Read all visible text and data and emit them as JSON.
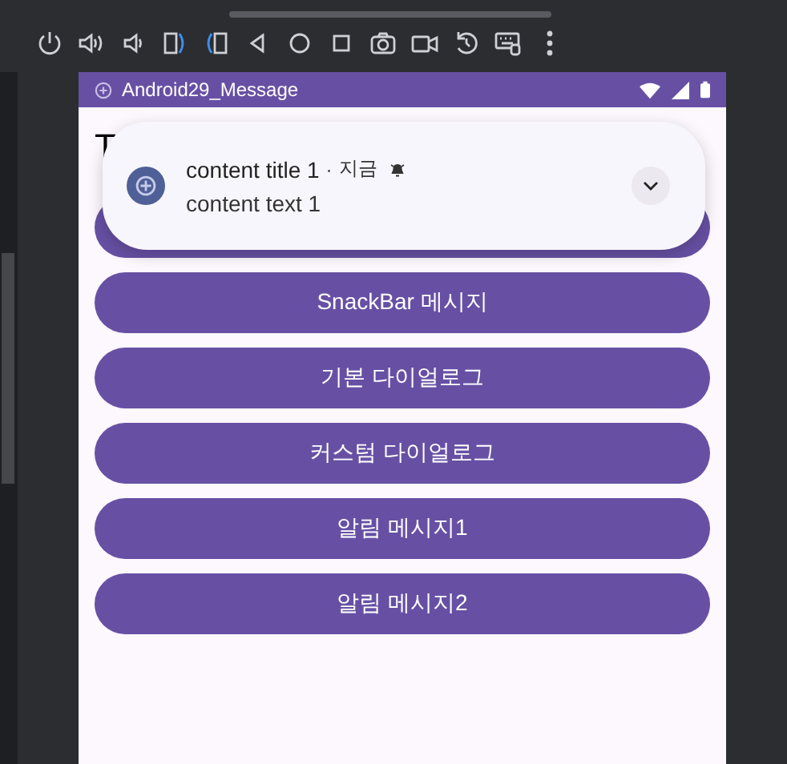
{
  "status_bar": {
    "app_name": "Android29_Message"
  },
  "screen": {
    "title": "T",
    "buttons": [
      {
        "kind": "covered"
      },
      {
        "kind": "labeled",
        "label": "SnackBar 메시지"
      },
      {
        "kind": "labeled",
        "label": "기본 다이얼로그"
      },
      {
        "kind": "labeled",
        "label": "커스텀 다이얼로그"
      },
      {
        "kind": "labeled",
        "label": "알림 메시지1"
      },
      {
        "kind": "labeled",
        "label": "알림 메시지2"
      }
    ]
  },
  "notification": {
    "title": "content title 1",
    "separator": "·",
    "time": "지금",
    "text": "content text 1",
    "expanded": false
  }
}
